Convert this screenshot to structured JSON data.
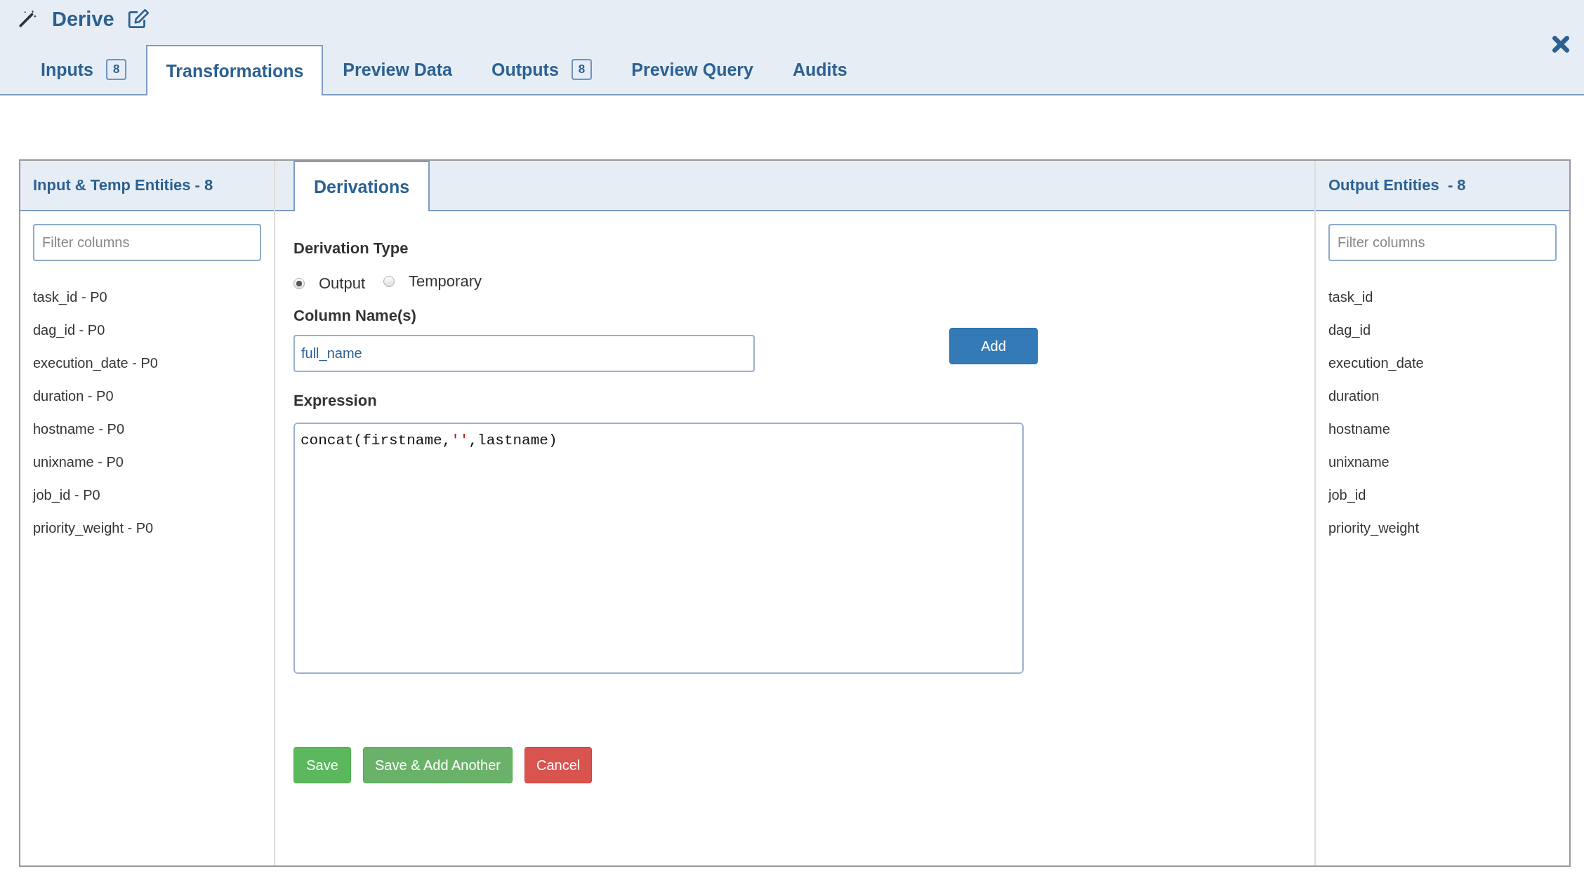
{
  "header": {
    "title": "Derive"
  },
  "tabs": [
    {
      "label": "Inputs",
      "badge": "8",
      "selected": false
    },
    {
      "label": "Transformations",
      "selected": true
    },
    {
      "label": "Preview Data",
      "selected": false
    },
    {
      "label": "Outputs",
      "badge": "8",
      "selected": false
    },
    {
      "label": "Preview Query",
      "selected": false
    },
    {
      "label": "Audits",
      "selected": false
    }
  ],
  "left_panel": {
    "title": "Input & Temp Entities - 8",
    "filter": {
      "placeholder": "Filter columns"
    },
    "items": [
      "task_id - P0",
      "dag_id - P0",
      "execution_date - P0",
      "duration - P0",
      "hostname - P0",
      "unixname - P0",
      "job_id - P0",
      "priority_weight - P0"
    ]
  },
  "center": {
    "tabs": [
      {
        "label": "Derivations",
        "selected": true
      }
    ],
    "derivation_type": {
      "label": "Derivation Type",
      "options": [
        {
          "label": "Output",
          "selected": true
        },
        {
          "label": "Temporary",
          "selected": false
        }
      ]
    },
    "column_names": {
      "label": "Column Name(s)",
      "value": "full_name",
      "add_button": "Add"
    },
    "expression": {
      "label": "Expression",
      "tokens": [
        {
          "text": "concat(firstname,",
          "kind": "plain"
        },
        {
          "text": "''",
          "kind": "string"
        },
        {
          "text": ",lastname)",
          "kind": "plain"
        }
      ]
    },
    "buttons": [
      {
        "label": "Save",
        "kind": "success"
      },
      {
        "label": "Save & Add Another",
        "kind": "success-light"
      },
      {
        "label": "Cancel",
        "kind": "danger"
      }
    ]
  },
  "right_panel": {
    "title": "Output Entities  - 8",
    "filter": {
      "placeholder": "Filter columns"
    },
    "items": [
      "task_id",
      "dag_id",
      "execution_date",
      "duration",
      "hostname",
      "unixname",
      "job_id",
      "priority_weight"
    ]
  }
}
